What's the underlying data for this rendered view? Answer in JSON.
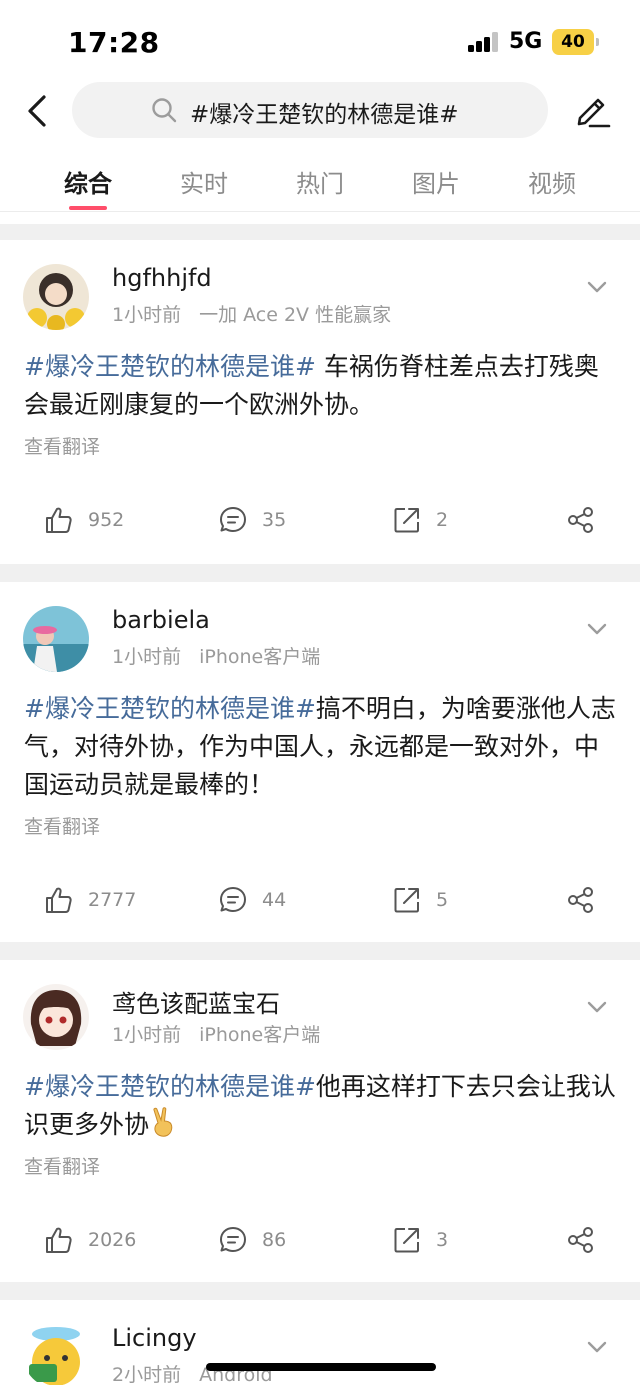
{
  "status_bar": {
    "time": "17:28",
    "network": "5G",
    "battery": "40"
  },
  "search": {
    "query": "#爆冷王楚钦的林德是谁#"
  },
  "tabs": [
    {
      "label": "综合",
      "active": true
    },
    {
      "label": "实时",
      "active": false
    },
    {
      "label": "热门",
      "active": false
    },
    {
      "label": "图片",
      "active": false
    },
    {
      "label": "视频",
      "active": false
    }
  ],
  "posts": [
    {
      "username": "hgfhhjfd",
      "time": "1小时前",
      "device": "一加 Ace 2V 性能赢家",
      "hashtag": "#爆冷王楚钦的林德是谁#",
      "text": " 车祸伤脊柱差点去打残奥会最近刚康复的一个欧洲外协。",
      "translate": "查看翻译",
      "likes": "952",
      "comments": "35",
      "reposts": "2"
    },
    {
      "username": "barbiela",
      "time": "1小时前",
      "device": "iPhone客户端",
      "hashtag": "#爆冷王楚钦的林德是谁#",
      "text": "搞不明白，为啥要涨他人志气，对待外协，作为中国人，永远都是一致对外，中国运动员就是最棒的！",
      "translate": "查看翻译",
      "likes": "2777",
      "comments": "44",
      "reposts": "5"
    },
    {
      "username": "鸢色该配蓝宝石",
      "time": "1小时前",
      "device": "iPhone客户端",
      "hashtag": "#爆冷王楚钦的林德是谁#",
      "text": "他再这样打下去只会让我认识更多外协",
      "emoji": "victory-hand-emoji",
      "translate": "查看翻译",
      "likes": "2026",
      "comments": "86",
      "reposts": "3"
    },
    {
      "username": "Licingy",
      "time": "2小时前",
      "device": "Android"
    }
  ],
  "icons": {
    "back": "chevron-left-icon",
    "search": "magnifier-icon",
    "edit": "pencil-icon",
    "more": "chevron-down-icon",
    "like": "thumbs-up-icon",
    "comment": "comment-bubble-icon",
    "repost": "repost-icon",
    "share": "share-icon"
  },
  "colors": {
    "hashtag": "#466b9a",
    "tab_indicator": "#ff4e6a",
    "battery": "#f7d046"
  }
}
